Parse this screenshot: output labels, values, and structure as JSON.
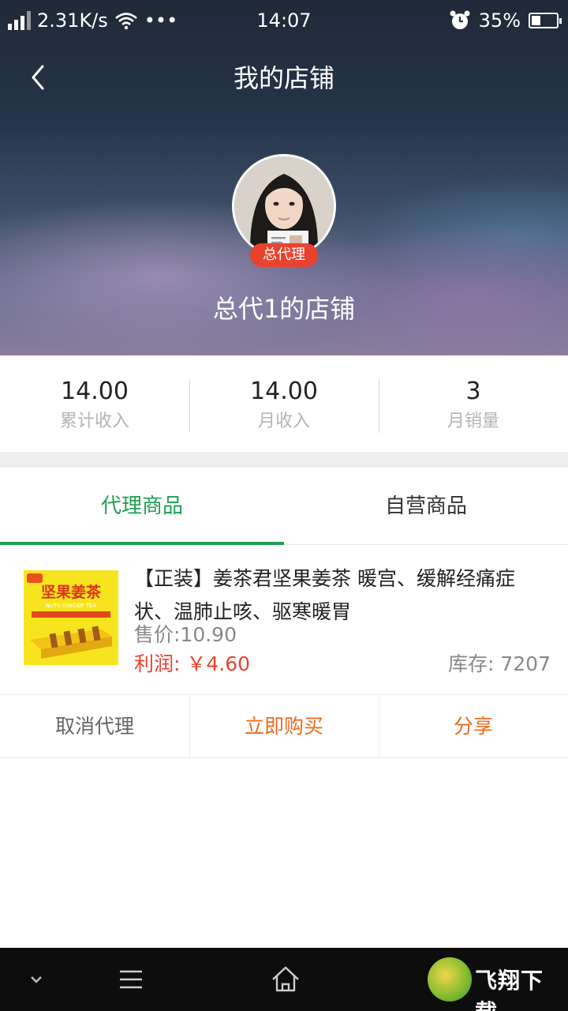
{
  "status_bar": {
    "net_speed": "2.31K/s",
    "dots": "•••",
    "time": "14:07",
    "battery": "35%",
    "battery_level": 0.35
  },
  "header": {
    "title": "我的店铺",
    "badge": "总代理",
    "shop_name": "总代1的店铺"
  },
  "stats": [
    {
      "value": "14.00",
      "label": "累计收入"
    },
    {
      "value": "14.00",
      "label": "月收入"
    },
    {
      "value": "3",
      "label": "月销量"
    }
  ],
  "tabs": [
    {
      "label": "代理商品",
      "active": true
    },
    {
      "label": "自营商品",
      "active": false
    }
  ],
  "product": {
    "title": "【正装】姜茶君坚果姜茶  暖宫、缓解经痛症状、温肺止咳、驱寒暖胃",
    "price": "售价:10.90",
    "profit": "利润: ￥4.60",
    "stock": "库存: 7207",
    "thumb_text": "坚果姜茶",
    "thumb_subtext": "NUTS GINGER TEA"
  },
  "actions": {
    "cancel": "取消代理",
    "buy": "立即购买",
    "share": "分享"
  },
  "watermark": {
    "text": "飞翔下载"
  },
  "colors": {
    "accent_green": "#20a052",
    "badge_red": "#e8432f",
    "action_orange": "#ee6a1e"
  }
}
